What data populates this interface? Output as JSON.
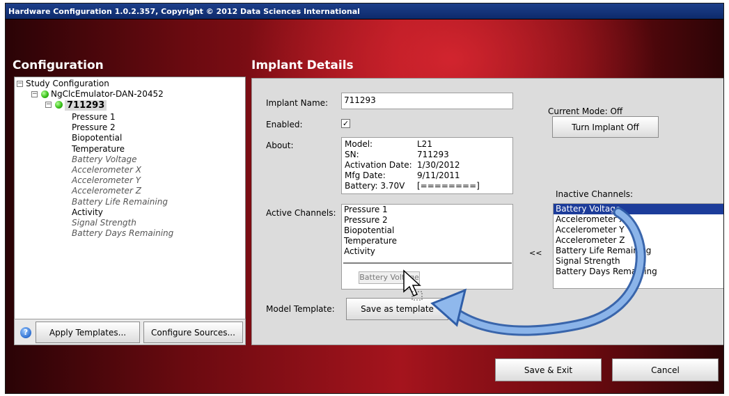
{
  "window": {
    "title": "Hardware Configuration 1.0.2.357, Copyright © 2012 Data Sciences International"
  },
  "configuration": {
    "title": "Configuration",
    "tree": {
      "root": "Study Configuration",
      "device": "NgClcEmulator-DAN-20452",
      "implant": "711293",
      "channels": [
        {
          "label": "Pressure 1",
          "active": true
        },
        {
          "label": "Pressure 2",
          "active": true
        },
        {
          "label": "Biopotential",
          "active": true
        },
        {
          "label": "Temperature",
          "active": true
        },
        {
          "label": "Battery Voltage",
          "active": false
        },
        {
          "label": "Accelerometer X",
          "active": false
        },
        {
          "label": "Accelerometer Y",
          "active": false
        },
        {
          "label": "Accelerometer Z",
          "active": false
        },
        {
          "label": "Battery Life Remaining",
          "active": false
        },
        {
          "label": "Activity",
          "active": true
        },
        {
          "label": "Signal Strength",
          "active": false
        },
        {
          "label": "Battery Days Remaining",
          "active": false
        }
      ]
    },
    "apply_templates_label": "Apply Templates...",
    "configure_sources_label": "Configure Sources..."
  },
  "implant": {
    "title": "Implant Details",
    "name_label": "Implant Name:",
    "name_value": "711293",
    "enabled_label": "Enabled:",
    "enabled_checked": true,
    "about_label": "About:",
    "about": {
      "model_k": "Model:",
      "model_v": "L21",
      "sn_k": "SN:",
      "sn_v": "711293",
      "activation_k": "Activation Date:",
      "activation_v": "1/30/2012",
      "mfg_k": "Mfg Date:",
      "mfg_v": "9/11/2011",
      "battery_k": "Battery: 3.70V",
      "battery_v": "[========]"
    },
    "current_mode": "Current Mode: Off",
    "turn_off_label": "Turn Implant Off",
    "active_label": "Active Channels:",
    "active_channels": [
      "Pressure 1",
      "Pressure 2",
      "Biopotential",
      "Temperature",
      "Activity"
    ],
    "drag_ghost": "Battery Voltage",
    "move_left_label": "<<",
    "inactive_label": "Inactive Channels:",
    "inactive_channels": [
      "Battery Voltage",
      "Accelerometer X",
      "Accelerometer Y",
      "Accelerometer Z",
      "Battery Life Remaining",
      "Signal Strength",
      "Battery Days Remaining"
    ],
    "inactive_selected_index": 0,
    "template_label": "Model Template:",
    "save_template_label": "Save as template"
  },
  "footer": {
    "save_exit_label": "Save & Exit",
    "cancel_label": "Cancel"
  },
  "colors": {
    "title_bar": "#1d3f8a",
    "selection": "#1c3c9a",
    "annotation_arrow": "#5b8fd6"
  }
}
